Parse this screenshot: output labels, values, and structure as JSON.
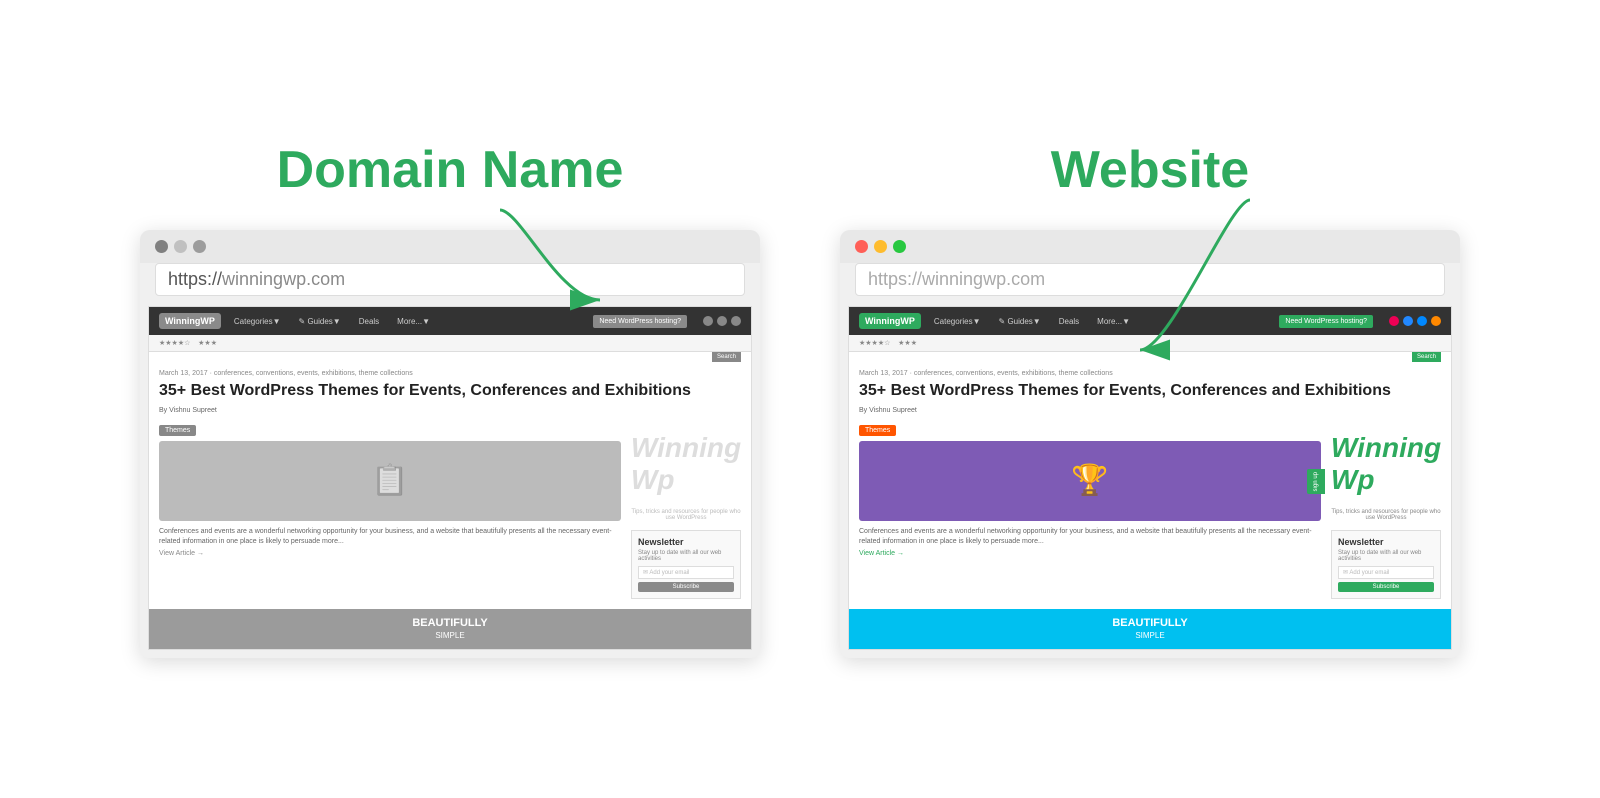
{
  "left": {
    "title": "Domain Name",
    "url_prefix": "https://",
    "url_domain": "winningwp.com",
    "url_full": "https://winningwp.com"
  },
  "right": {
    "title": "Website",
    "url_prefix": "https://",
    "url_domain": "winningwp.com",
    "url_full": "https://winningwp.com"
  },
  "browser": {
    "article_meta": "March 13, 2017 · conferences, conventions, events, exhibitions, theme collections",
    "article_title": "35+ Best WordPress Themes for Events, Conferences and Exhibitions",
    "article_author": "By Vishnu Supreet",
    "theme_badge": "Themes",
    "article_excerpt": "Conferences and events are a wonderful networking opportunity for your business, and a website that beautifully presents all the necessary event-related information in one place is likely to persuade more...",
    "view_article": "View Article →",
    "newsletter_title": "Newsletter",
    "newsletter_desc": "Stay up to date with all our web activities",
    "newsletter_placeholder": "✉ Add your email",
    "newsletter_btn": "Subscribe",
    "footer_text": "BEAUTIFULLY",
    "footer_sub": "SIMPLE",
    "nav_cta": "Need WordPress hosting?",
    "search_btn": "Search",
    "categories": "Categories▼",
    "guides": "✎ Guides▼",
    "deals": "Deals",
    "more": "More...▼"
  },
  "colors": {
    "green": "#2eaa5e",
    "red_dot": "#ff5f57",
    "yellow_dot": "#febc2e",
    "green_dot": "#28c840"
  }
}
